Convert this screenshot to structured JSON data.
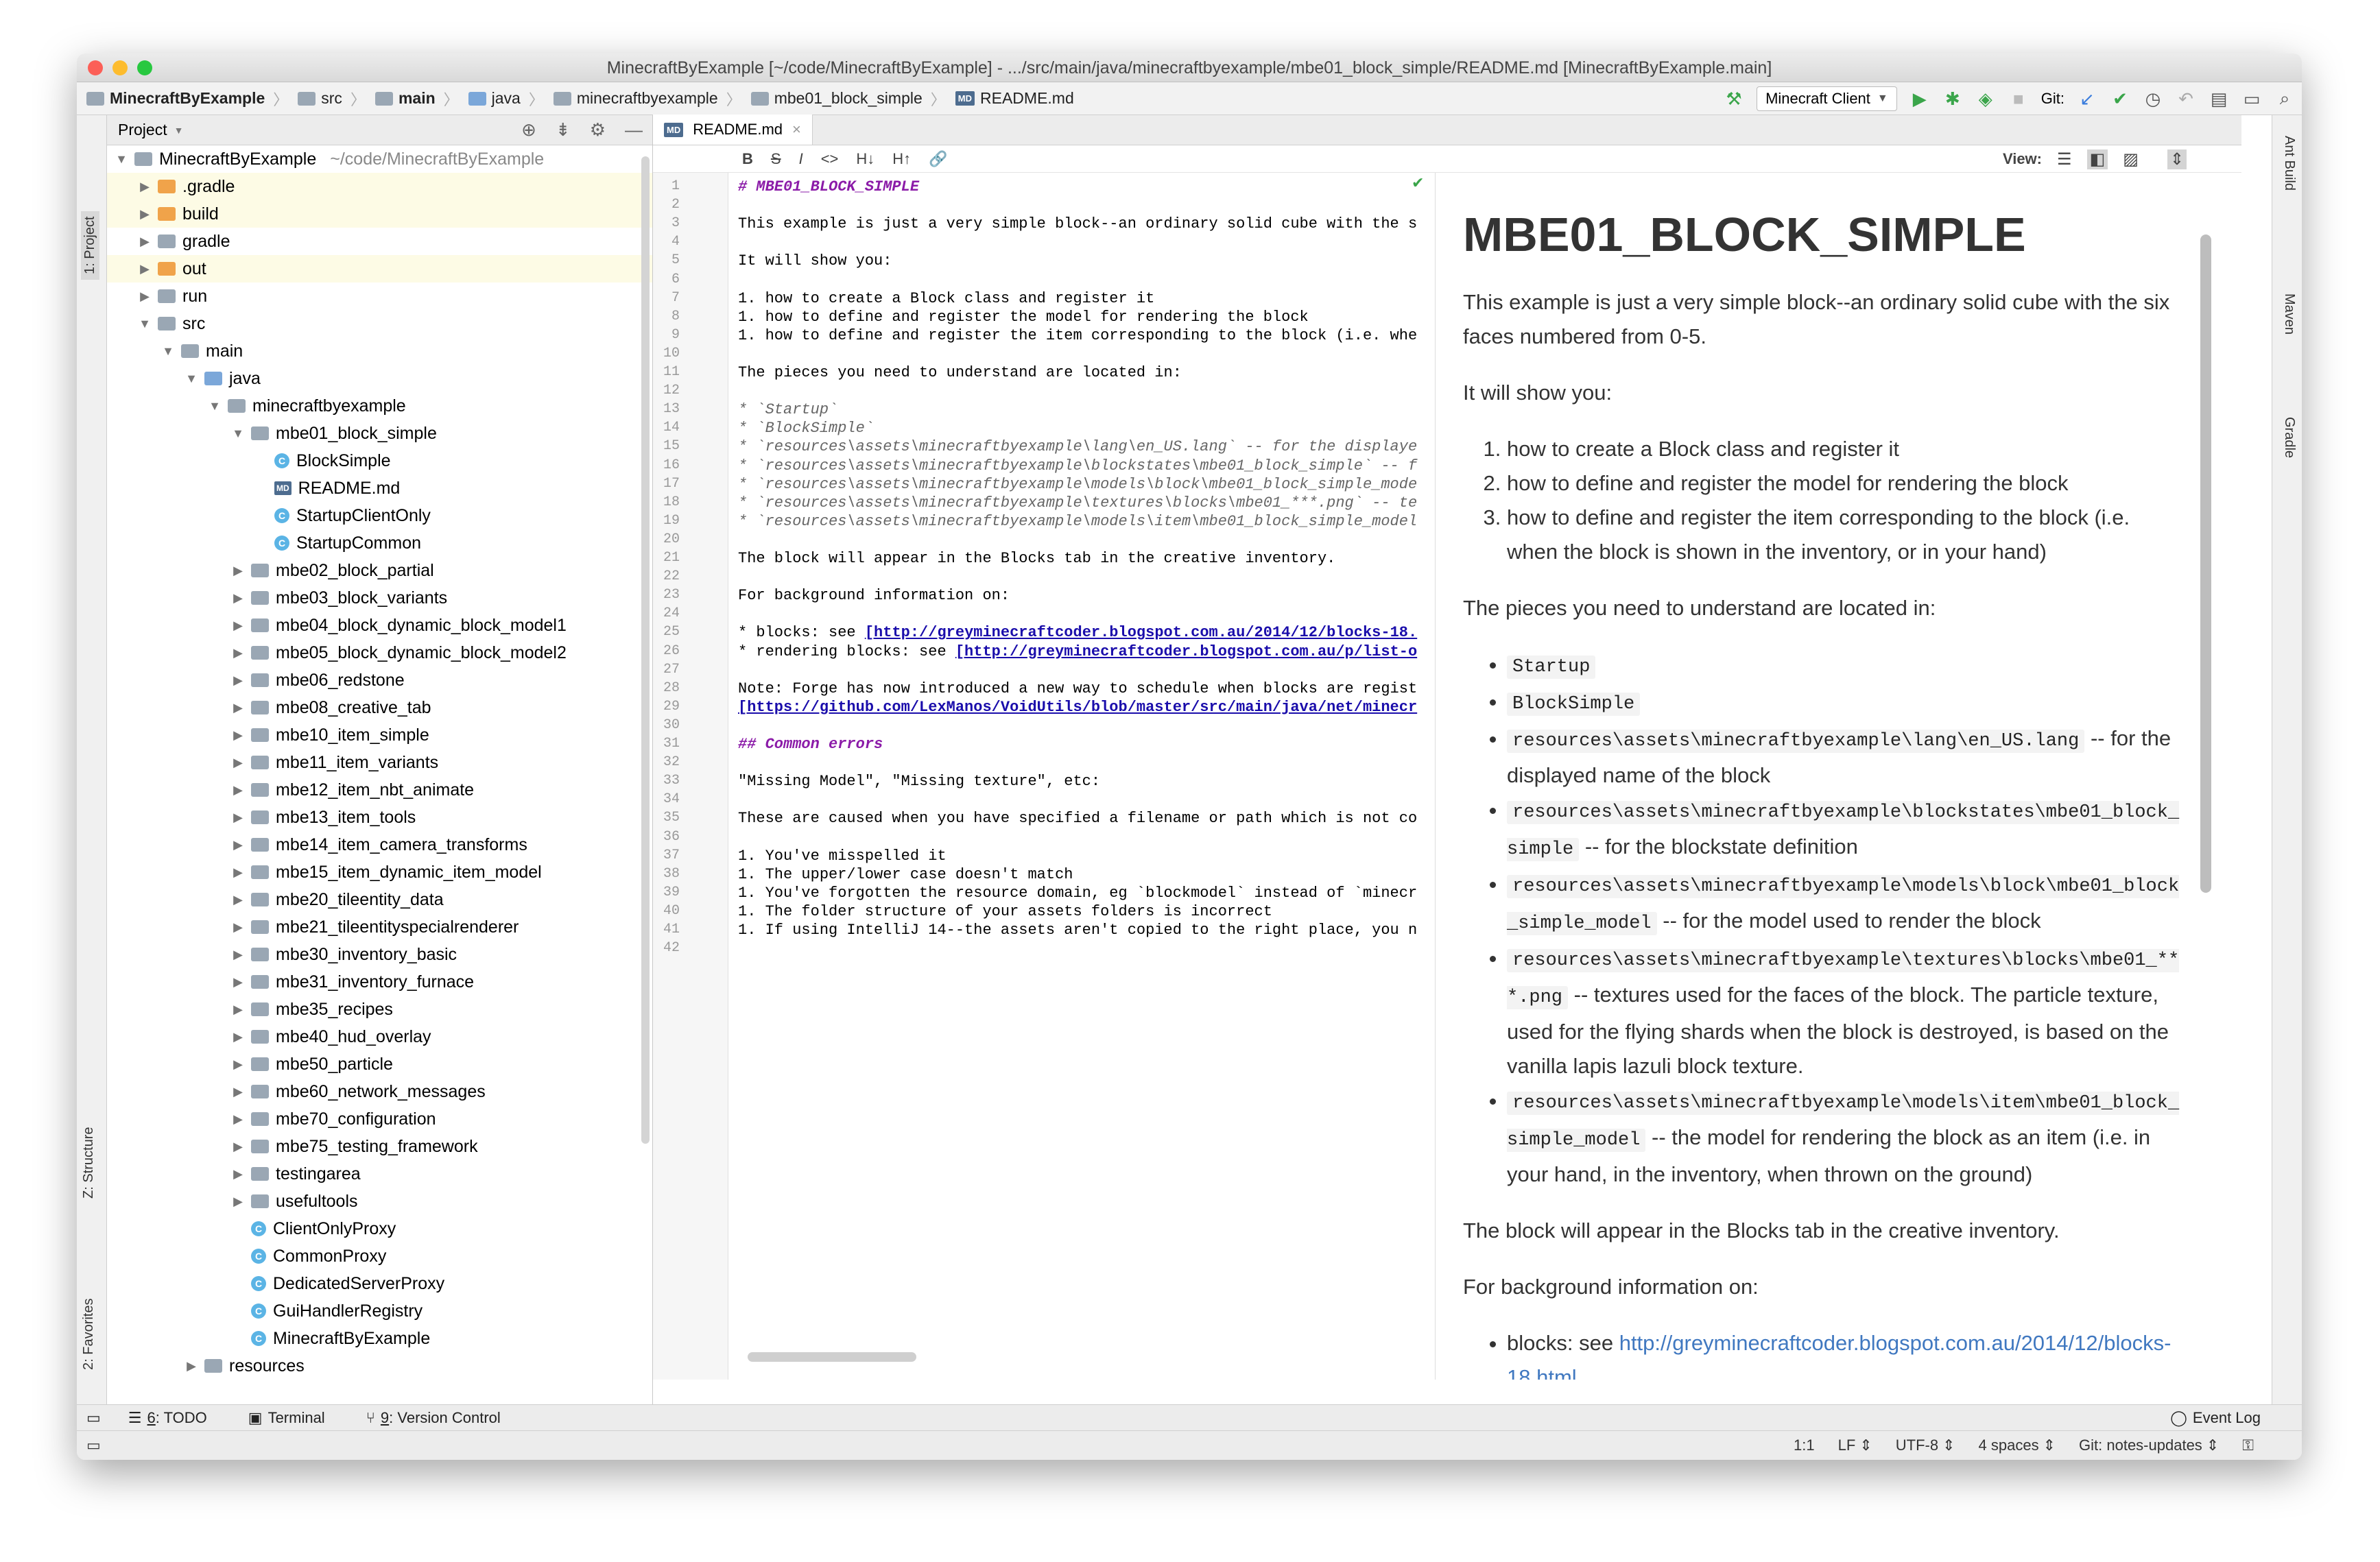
{
  "window": {
    "title": "MinecraftByExample [~/code/MinecraftByExample] - .../src/main/java/minecraftbyexample/mbe01_block_simple/README.md [MinecraftByExample.main]"
  },
  "colors": {
    "close": "#fc5f57",
    "minimize": "#fdbc2e",
    "zoom": "#28c840",
    "run": "#3aa54a",
    "link": "#4078c0"
  },
  "breadcrumbs": [
    "MinecraftByExample",
    "src",
    "main",
    "java",
    "minecraftbyexample",
    "mbe01_block_simple",
    "README.md"
  ],
  "toolbar": {
    "run_config": "Minecraft Client",
    "git_label": "Git:"
  },
  "project_panel": {
    "title": "Project",
    "root": "MinecraftByExample",
    "root_path": "~/code/MinecraftByExample",
    "items": [
      {
        "label": ".gradle",
        "depth": 1,
        "icon": "folder-orange",
        "arrow": "collapsed",
        "hl": true
      },
      {
        "label": "build",
        "depth": 1,
        "icon": "folder-orange",
        "arrow": "collapsed",
        "hl": true
      },
      {
        "label": "gradle",
        "depth": 1,
        "icon": "folder-gray",
        "arrow": "collapsed",
        "hl": false
      },
      {
        "label": "out",
        "depth": 1,
        "icon": "folder-orange",
        "arrow": "collapsed",
        "hl": true
      },
      {
        "label": "run",
        "depth": 1,
        "icon": "folder-gray",
        "arrow": "collapsed",
        "hl": false
      },
      {
        "label": "src",
        "depth": 1,
        "icon": "folder-gray",
        "arrow": "expanded",
        "hl": false
      },
      {
        "label": "main",
        "depth": 2,
        "icon": "folder-gray",
        "arrow": "expanded",
        "hl": false
      },
      {
        "label": "java",
        "depth": 3,
        "icon": "folder-blue",
        "arrow": "expanded",
        "hl": false
      },
      {
        "label": "minecraftbyexample",
        "depth": 4,
        "icon": "folder-gray",
        "arrow": "expanded",
        "hl": false
      },
      {
        "label": "mbe01_block_simple",
        "depth": 5,
        "icon": "folder-gray",
        "arrow": "expanded",
        "hl": false
      },
      {
        "label": "BlockSimple",
        "depth": 6,
        "icon": "class",
        "arrow": "none",
        "hl": false
      },
      {
        "label": "README.md",
        "depth": 6,
        "icon": "md",
        "arrow": "none",
        "hl": false
      },
      {
        "label": "StartupClientOnly",
        "depth": 6,
        "icon": "class",
        "arrow": "none",
        "hl": false
      },
      {
        "label": "StartupCommon",
        "depth": 6,
        "icon": "class",
        "arrow": "none",
        "hl": false
      },
      {
        "label": "mbe02_block_partial",
        "depth": 5,
        "icon": "folder-gray",
        "arrow": "collapsed",
        "hl": false
      },
      {
        "label": "mbe03_block_variants",
        "depth": 5,
        "icon": "folder-gray",
        "arrow": "collapsed",
        "hl": false
      },
      {
        "label": "mbe04_block_dynamic_block_model1",
        "depth": 5,
        "icon": "folder-gray",
        "arrow": "collapsed",
        "hl": false
      },
      {
        "label": "mbe05_block_dynamic_block_model2",
        "depth": 5,
        "icon": "folder-gray",
        "arrow": "collapsed",
        "hl": false
      },
      {
        "label": "mbe06_redstone",
        "depth": 5,
        "icon": "folder-gray",
        "arrow": "collapsed",
        "hl": false
      },
      {
        "label": "mbe08_creative_tab",
        "depth": 5,
        "icon": "folder-gray",
        "arrow": "collapsed",
        "hl": false
      },
      {
        "label": "mbe10_item_simple",
        "depth": 5,
        "icon": "folder-gray",
        "arrow": "collapsed",
        "hl": false
      },
      {
        "label": "mbe11_item_variants",
        "depth": 5,
        "icon": "folder-gray",
        "arrow": "collapsed",
        "hl": false
      },
      {
        "label": "mbe12_item_nbt_animate",
        "depth": 5,
        "icon": "folder-gray",
        "arrow": "collapsed",
        "hl": false
      },
      {
        "label": "mbe13_item_tools",
        "depth": 5,
        "icon": "folder-gray",
        "arrow": "collapsed",
        "hl": false
      },
      {
        "label": "mbe14_item_camera_transforms",
        "depth": 5,
        "icon": "folder-gray",
        "arrow": "collapsed",
        "hl": false
      },
      {
        "label": "mbe15_item_dynamic_item_model",
        "depth": 5,
        "icon": "folder-gray",
        "arrow": "collapsed",
        "hl": false
      },
      {
        "label": "mbe20_tileentity_data",
        "depth": 5,
        "icon": "folder-gray",
        "arrow": "collapsed",
        "hl": false
      },
      {
        "label": "mbe21_tileentityspecialrenderer",
        "depth": 5,
        "icon": "folder-gray",
        "arrow": "collapsed",
        "hl": false
      },
      {
        "label": "mbe30_inventory_basic",
        "depth": 5,
        "icon": "folder-gray",
        "arrow": "collapsed",
        "hl": false
      },
      {
        "label": "mbe31_inventory_furnace",
        "depth": 5,
        "icon": "folder-gray",
        "arrow": "collapsed",
        "hl": false
      },
      {
        "label": "mbe35_recipes",
        "depth": 5,
        "icon": "folder-gray",
        "arrow": "collapsed",
        "hl": false
      },
      {
        "label": "mbe40_hud_overlay",
        "depth": 5,
        "icon": "folder-gray",
        "arrow": "collapsed",
        "hl": false
      },
      {
        "label": "mbe50_particle",
        "depth": 5,
        "icon": "folder-gray",
        "arrow": "collapsed",
        "hl": false
      },
      {
        "label": "mbe60_network_messages",
        "depth": 5,
        "icon": "folder-gray",
        "arrow": "collapsed",
        "hl": false
      },
      {
        "label": "mbe70_configuration",
        "depth": 5,
        "icon": "folder-gray",
        "arrow": "collapsed",
        "hl": false
      },
      {
        "label": "mbe75_testing_framework",
        "depth": 5,
        "icon": "folder-gray",
        "arrow": "collapsed",
        "hl": false
      },
      {
        "label": "testingarea",
        "depth": 5,
        "icon": "folder-gray",
        "arrow": "collapsed",
        "hl": false
      },
      {
        "label": "usefultools",
        "depth": 5,
        "icon": "folder-gray",
        "arrow": "collapsed",
        "hl": false
      },
      {
        "label": "ClientOnlyProxy",
        "depth": 5,
        "icon": "class",
        "arrow": "none",
        "hl": false
      },
      {
        "label": "CommonProxy",
        "depth": 5,
        "icon": "class",
        "arrow": "none",
        "hl": false
      },
      {
        "label": "DedicatedServerProxy",
        "depth": 5,
        "icon": "class",
        "arrow": "none",
        "hl": false
      },
      {
        "label": "GuiHandlerRegistry",
        "depth": 5,
        "icon": "class",
        "arrow": "none",
        "hl": false
      },
      {
        "label": "MinecraftByExample",
        "depth": 5,
        "icon": "class",
        "arrow": "none",
        "hl": false
      },
      {
        "label": "resources",
        "depth": 3,
        "icon": "folder-gray",
        "arrow": "collapsed",
        "hl": false
      }
    ]
  },
  "left_tool_tabs": [
    "1: Project",
    "Z: Structure",
    "2: Favorites"
  ],
  "right_tool_tabs": [
    "Ant Build",
    "Maven",
    "Gradle"
  ],
  "editor": {
    "tab": "README.md",
    "md_toolbar": [
      "B",
      "S",
      "I",
      "<>",
      "H↓",
      "H↑",
      "🔗"
    ],
    "view_label": "View:",
    "lines": [
      {
        "n": "1",
        "t": "# MBE01_BLOCK_SIMPLE",
        "s": "h"
      },
      {
        "n": "2",
        "t": "",
        "s": ""
      },
      {
        "n": "3",
        "t": "This example is just a very simple block--an ordinary solid cube with the s",
        "s": ""
      },
      {
        "n": "4",
        "t": "",
        "s": ""
      },
      {
        "n": "5",
        "t": "It will show you:",
        "s": ""
      },
      {
        "n": "6",
        "t": "",
        "s": ""
      },
      {
        "n": "7",
        "t": "1. how to create a Block class and register it",
        "s": ""
      },
      {
        "n": "8",
        "t": "1. how to define and register the model for rendering the block",
        "s": ""
      },
      {
        "n": "9",
        "t": "1. how to define and register the item corresponding to the block (i.e. whe",
        "s": ""
      },
      {
        "n": "10",
        "t": "",
        "s": ""
      },
      {
        "n": "11",
        "t": "The pieces you need to understand are located in:",
        "s": ""
      },
      {
        "n": "12",
        "t": "",
        "s": ""
      },
      {
        "n": "13",
        "t": "* `Startup`",
        "s": "i"
      },
      {
        "n": "14",
        "t": "* `BlockSimple`",
        "s": "i"
      },
      {
        "n": "15",
        "t": "* `resources\\assets\\minecraftbyexample\\lang\\en_US.lang` -- for the displaye",
        "s": "i"
      },
      {
        "n": "16",
        "t": "* `resources\\assets\\minecraftbyexample\\blockstates\\mbe01_block_simple` -- f",
        "s": "i"
      },
      {
        "n": "17",
        "t": "* `resources\\assets\\minecraftbyexample\\models\\block\\mbe01_block_simple_mode",
        "s": "i"
      },
      {
        "n": "18",
        "t": "* `resources\\assets\\minecraftbyexample\\textures\\blocks\\mbe01_***.png` -- te",
        "s": "i"
      },
      {
        "n": "19",
        "t": "* `resources\\assets\\minecraftbyexample\\models\\item\\mbe01_block_simple_model",
        "s": "i"
      },
      {
        "n": "20",
        "t": "",
        "s": ""
      },
      {
        "n": "21",
        "t": "The block will appear in the Blocks tab in the creative inventory.",
        "s": ""
      },
      {
        "n": "22",
        "t": "",
        "s": ""
      },
      {
        "n": "23",
        "t": "For background information on:",
        "s": ""
      },
      {
        "n": "24",
        "t": "",
        "s": ""
      },
      {
        "n": "25",
        "t": "* blocks: see [http://greyminecraftcoder.blogspot.com.au/2014/12/blocks-18.",
        "s": "l"
      },
      {
        "n": "26",
        "t": "* rendering blocks: see [http://greyminecraftcoder.blogspot.com.au/p/list-o",
        "s": "l"
      },
      {
        "n": "27",
        "t": "",
        "s": ""
      },
      {
        "n": "28",
        "t": "Note: Forge has now introduced a new way to schedule when blocks are regist",
        "s": ""
      },
      {
        "n": "29",
        "t": "[https://github.com/LexManos/VoidUtils/blob/master/src/main/java/net/minecr",
        "s": "lk"
      },
      {
        "n": "30",
        "t": "",
        "s": ""
      },
      {
        "n": "31",
        "t": "## Common errors",
        "s": "h"
      },
      {
        "n": "32",
        "t": "",
        "s": ""
      },
      {
        "n": "33",
        "t": "\"Missing Model\", \"Missing texture\", etc:",
        "s": ""
      },
      {
        "n": "34",
        "t": "",
        "s": ""
      },
      {
        "n": "35",
        "t": "These are caused when you have specified a filename or path which is not co",
        "s": ""
      },
      {
        "n": "36",
        "t": "",
        "s": ""
      },
      {
        "n": "37",
        "t": "1. You've misspelled it",
        "s": ""
      },
      {
        "n": "38",
        "t": "1. The upper/lower case doesn't match",
        "s": ""
      },
      {
        "n": "39",
        "t": "1. You've forgotten the resource domain, eg `blockmodel` instead of `minecr",
        "s": ""
      },
      {
        "n": "40",
        "t": "1. The folder structure of your assets folders is incorrect",
        "s": ""
      },
      {
        "n": "41",
        "t": "1. If using IntelliJ 14--the assets aren't copied to the right place, you n",
        "s": ""
      },
      {
        "n": "42",
        "t": "",
        "s": ""
      }
    ]
  },
  "preview": {
    "h1": "MBE01_BLOCK_SIMPLE",
    "intro": "This example is just a very simple block--an ordinary solid cube with the six faces numbered from 0-5.",
    "show": "It will show you:",
    "steps": [
      "how to create a Block class and register it",
      "how to define and register the model for rendering the block",
      "how to define and register the item corresponding to the block (i.e. when the block is shown in the inventory, or in your hand)"
    ],
    "pieces_intro": "The pieces you need to understand are located in:",
    "pieces": [
      {
        "code": "Startup",
        "text": ""
      },
      {
        "code": "BlockSimple",
        "text": ""
      },
      {
        "code": "resources\\assets\\minecraftbyexample\\lang\\en_US.lang",
        "text": " -- for the displayed name of the block"
      },
      {
        "code": "resources\\assets\\minecraftbyexample\\blockstates\\mbe01_block_simple",
        "text": " -- for the blockstate definition"
      },
      {
        "code": "resources\\assets\\minecraftbyexample\\models\\block\\mbe01_block_simple_model",
        "text": " -- for the model used to render the block"
      },
      {
        "code": "resources\\assets\\minecraftbyexample\\textures\\blocks\\mbe01_***.png",
        "text": " -- textures used for the faces of the block. The particle texture, used for the flying shards when the block is destroyed, is based on the vanilla lapis lazuli block texture."
      },
      {
        "code": "resources\\assets\\minecraftbyexample\\models\\item\\mbe01_block_simple_model",
        "text": " -- the model for rendering the block as an item (i.e. in your hand, in the inventory, when thrown on the ground)"
      }
    ],
    "appear": "The block will appear in the Blocks tab in the creative inventory.",
    "background": "For background information on:",
    "blocks_prefix": "blocks: see ",
    "blocks_link": "http://greyminecraftcoder.blogspot.com.au/2014/12/blocks-18.html"
  },
  "bottom_tabs": [
    {
      "num": "6",
      "label": ": TODO",
      "icon": "☰"
    },
    {
      "num": "",
      "label": "Terminal",
      "icon": "▣"
    },
    {
      "num": "9",
      "label": ": Version Control",
      "icon": "⑂"
    }
  ],
  "event_log": "Event Log",
  "status": {
    "position": "1:1",
    "line_sep": "LF",
    "encoding": "UTF-8",
    "indent": "4 spaces",
    "git": "Git: notes-updates"
  }
}
